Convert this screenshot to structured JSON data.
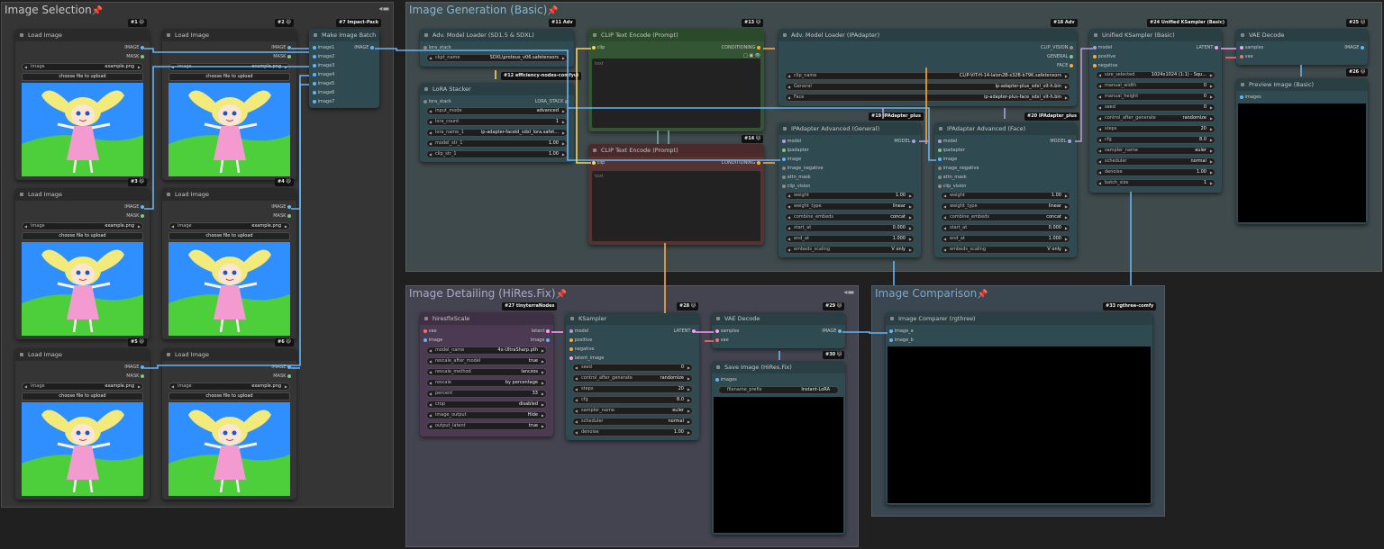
{
  "groups": {
    "selection": "Image Selection",
    "generation": "Image Generation (Basic)",
    "detailing": "Image Detailing (HiRes.Fix)",
    "comparison": "Image Comparison"
  },
  "labels": {
    "load_image": "Load Image",
    "image": "IMAGE",
    "mask": "MASK",
    "image_widget": "image",
    "example_png": "example.png",
    "choose_file": "choose file to upload",
    "conditioning": "CONDITIONING",
    "clip": "clip",
    "text": "text",
    "clip_text_encode": "CLIP Text Encode (Prompt)"
  },
  "badges": {
    "b1": "#1 🐱",
    "b2": "#2 🐱",
    "b3": "#3 🐱",
    "b4": "#4 🐱",
    "b5": "#5 🐱",
    "b6": "#6 🐱",
    "b7": "#7 Impact-Pack",
    "b11": "#11 Adv",
    "b12": "#12 efficiency-nodes-comfyui",
    "b13": "#13 🐱",
    "b14": "#14 🐱",
    "b18": "#18 Adv",
    "b19": "#19 IPAdapter_plus",
    "b20": "#20 IPAdapter_plus",
    "b24": "#24 Unified KSampler (Basic)",
    "b25": "#25 🐱",
    "b26": "#26 🐱",
    "b27": "#27 tinyterraNodes",
    "b28": "#28 🐱",
    "b29": "#29 🐱",
    "b30": "#30 🐱",
    "b33": "#33 rgthree-comfy"
  },
  "make_batch": {
    "title": "Make Image Batch",
    "inputs": [
      "image1",
      "image2",
      "image3",
      "image4",
      "image5",
      "image6",
      "image7"
    ],
    "output": "IMAGE"
  },
  "adv_loader": {
    "title": "Adv. Model Loader (SD1.5 & SDXL)",
    "input": "lora_stack",
    "ckpt_label": "ckpt_name",
    "ckpt_value": "SDXL\\proteus_v06.safetensors"
  },
  "lora_stacker": {
    "title": "LoRA Stacker",
    "input": "lora_stack",
    "output": "LORA_STACK",
    "widgets": [
      {
        "label": "input_mode",
        "value": "advanced"
      },
      {
        "label": "lora_count",
        "value": "1"
      },
      {
        "label": "lora_name_1",
        "value": "ip-adapter-faceid_sdxl_lora.safet..."
      },
      {
        "label": "model_str_1",
        "value": "1.00"
      },
      {
        "label": "clip_str_1",
        "value": "1.00"
      }
    ]
  },
  "ipa_loader": {
    "title": "Adv. Model Loader (IPAdapter)",
    "outputs": [
      "CLIP_VISION",
      "GENERAL",
      "FACE"
    ],
    "widgets": [
      {
        "label": "clip_name",
        "value": "CLIP-ViT-H-14-laion2B-s32B-b79K.safetensors"
      },
      {
        "label": "General",
        "value": "ip-adapter-plus_sdxl_vit-h.bin"
      },
      {
        "label": "Face",
        "value": "ip-adapter-plus-face_sdxl_vit-h.bin"
      }
    ]
  },
  "ipa_general": {
    "title": "IPAdapter Advanced (General)",
    "output": "MODEL",
    "inputs": [
      "model",
      "ipadapter",
      "image",
      "image_negative",
      "attn_mask",
      "clip_vision"
    ],
    "widgets": [
      {
        "label": "weight",
        "value": "1.00"
      },
      {
        "label": "weight_type",
        "value": "linear"
      },
      {
        "label": "combine_embeds",
        "value": "concat"
      },
      {
        "label": "start_at",
        "value": "0.000"
      },
      {
        "label": "end_at",
        "value": "1.000"
      },
      {
        "label": "embeds_scaling",
        "value": "V only"
      }
    ]
  },
  "ipa_face": {
    "title": "IPAdapter Advanced (Face)",
    "output": "MODEL",
    "inputs": [
      "model",
      "ipadapter",
      "image",
      "image_negative",
      "attn_mask",
      "clip_vision"
    ],
    "widgets": [
      {
        "label": "weight",
        "value": "1.00"
      },
      {
        "label": "weight_type",
        "value": "linear"
      },
      {
        "label": "combine_embeds",
        "value": "concat"
      },
      {
        "label": "start_at",
        "value": "0.000"
      },
      {
        "label": "end_at",
        "value": "1.000"
      },
      {
        "label": "embeds_scaling",
        "value": "V only"
      }
    ]
  },
  "unified_ks": {
    "title": "Unified KSampler (Basic)",
    "output": "LATENT",
    "inputs": [
      "model",
      "positive",
      "negative"
    ],
    "widgets": [
      {
        "label": "size_selected",
        "value": "1024x1024 (1:1) - Squ..."
      },
      {
        "label": "manual_width",
        "value": "0"
      },
      {
        "label": "manual_height",
        "value": "0"
      },
      {
        "label": "seed",
        "value": "0"
      },
      {
        "label": "control_after_generate",
        "value": "randomize"
      },
      {
        "label": "steps",
        "value": "20"
      },
      {
        "label": "cfg",
        "value": "8.0"
      },
      {
        "label": "sampler_name",
        "value": "euler"
      },
      {
        "label": "scheduler",
        "value": "normal"
      },
      {
        "label": "denoise",
        "value": "1.00"
      },
      {
        "label": "batch_size",
        "value": "1"
      }
    ]
  },
  "vae_decode_1": {
    "title": "VAE Decode",
    "inputs": [
      "samples",
      "vae"
    ],
    "output": "IMAGE"
  },
  "preview": {
    "title": "Preview Image (Basic)",
    "input": "images"
  },
  "hires": {
    "title": "hiresfixScale",
    "inputs": [
      "vae",
      "image"
    ],
    "outputs": [
      "latent",
      "image"
    ],
    "widgets": [
      {
        "label": "model_name",
        "value": "4x-UltraSharp.pth"
      },
      {
        "label": "rescale_after_model",
        "value": "true"
      },
      {
        "label": "rescale_method",
        "value": "lanczos"
      },
      {
        "label": "rescale",
        "value": "by percentage"
      },
      {
        "label": "percent",
        "value": "33"
      },
      {
        "label": "crop",
        "value": "disabled"
      },
      {
        "label": "image_output",
        "value": "Hide"
      },
      {
        "label": "output_latent",
        "value": "true"
      }
    ]
  },
  "ksampler": {
    "title": "KSampler",
    "output": "LATENT",
    "inputs": [
      "model",
      "positive",
      "negative",
      "latent_image"
    ],
    "widgets": [
      {
        "label": "seed",
        "value": "0"
      },
      {
        "label": "control_after_generate",
        "value": "randomize"
      },
      {
        "label": "steps",
        "value": "20"
      },
      {
        "label": "cfg",
        "value": "8.0"
      },
      {
        "label": "sampler_name",
        "value": "euler"
      },
      {
        "label": "scheduler",
        "value": "normal"
      },
      {
        "label": "denoise",
        "value": "1.00"
      }
    ]
  },
  "vae_decode_2": {
    "title": "VAE Decode",
    "inputs": [
      "samples",
      "vae"
    ],
    "output": "IMAGE"
  },
  "save_image": {
    "title": "Save Image (HiRes.Fix)",
    "input": "images",
    "prefix_label": "filename_prefix",
    "prefix_value": "Instant-LoRA"
  },
  "comparer": {
    "title": "Image Comparer (rgthree)",
    "inputs": [
      "image_a",
      "image_b"
    ]
  },
  "colors": {
    "group_selection": "#3a3a3a",
    "group_generation": "#3f4a4c",
    "group_detailing": "#444450",
    "group_comparison": "#3a4650",
    "clip_node": "#335533",
    "clip_neg_node": "#553333",
    "hires_node": "#4b3a52",
    "accent_title_gen": "#8bd",
    "wire_image": "#64b5f6",
    "wire_model": "#b39ddb",
    "wire_clip": "#ffd54f",
    "wire_cond": "#ffa931",
    "wire_latent": "#ff9cf9",
    "wire_vae": "#ff6e6e"
  }
}
